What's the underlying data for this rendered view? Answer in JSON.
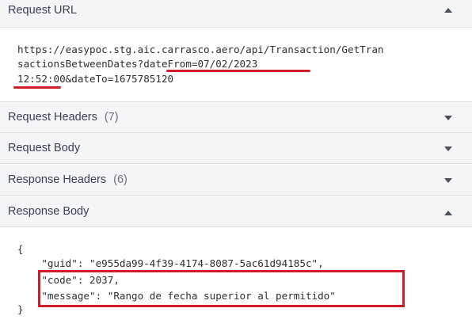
{
  "request_url": {
    "title": "Request URL",
    "line1": "https://easypoc.stg.aic.carrasco.aero/api/Transaction/GetTran",
    "line2": "sactionsBetweenDates?dateFrom=07/02/2023",
    "line3": "12:52:00&dateTo=1675785120",
    "expanded": true
  },
  "request_headers": {
    "title": "Request Headers",
    "count": "(7)",
    "expanded": false
  },
  "request_body": {
    "title": "Request Body",
    "expanded": false
  },
  "response_headers": {
    "title": "Response Headers",
    "count": "(6)",
    "expanded": false
  },
  "response_body": {
    "title": "Response Body",
    "expanded": true,
    "lines": [
      "{",
      "    \"guid\": \"e955da99-4f39-4174-8087-5ac61d94185c\",",
      "    \"code\": 2037,",
      "    \"message\": \"Rango de fecha superior al permitido\"",
      "}"
    ]
  },
  "colors": {
    "highlight": "#d01b2a",
    "header_bg": "#f4f5f7",
    "text": "#3b4151"
  },
  "icons": {
    "expanded": "chevron-up-icon",
    "collapsed": "chevron-down-icon"
  }
}
